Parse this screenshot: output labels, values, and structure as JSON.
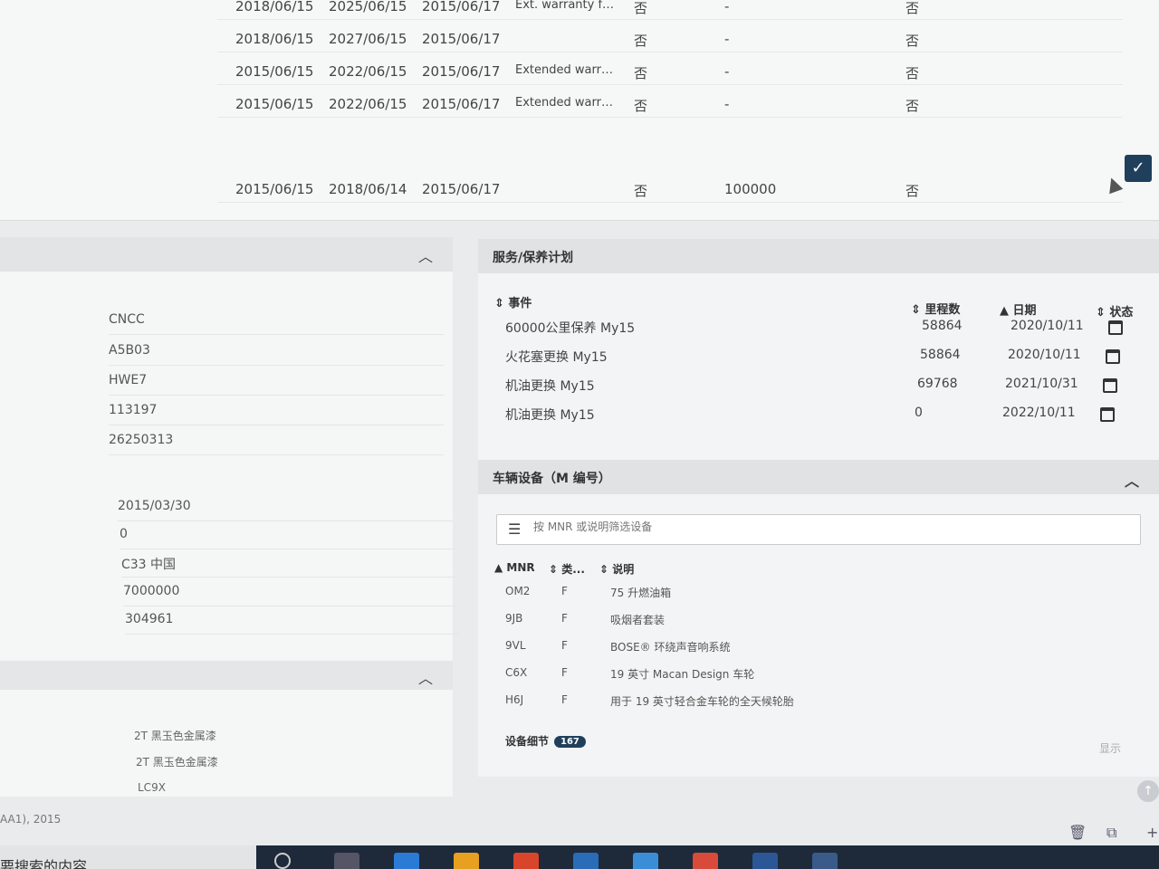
{
  "warranty": {
    "rows": [
      {
        "start": "2018/06/15",
        "end": "2025/06/15",
        "reg": "2015/06/17",
        "desc": "Ext. warranty for ...",
        "flag": "否",
        "mileage": "-",
        "flag2": "否"
      },
      {
        "start": "2018/06/15",
        "end": "2027/06/15",
        "reg": "2015/06/17",
        "desc": "",
        "flag": "否",
        "mileage": "-",
        "flag2": "否"
      },
      {
        "start": "2015/06/15",
        "end": "2022/06/15",
        "reg": "2015/06/17",
        "desc": "Extended warrant...",
        "flag": "否",
        "mileage": "-",
        "flag2": "否"
      },
      {
        "start": "2015/06/15",
        "end": "2022/06/15",
        "reg": "2015/06/17",
        "desc": "Extended warrant...",
        "flag": "否",
        "mileage": "-",
        "flag2": "否"
      },
      {
        "start": "2015/06/15",
        "end": "2018/06/14",
        "reg": "2015/06/17",
        "desc": "",
        "flag": "否",
        "mileage": "100000",
        "flag2": "否"
      }
    ]
  },
  "left": {
    "group1": [
      "CNCC",
      "A5B03",
      "HWE7",
      "113197",
      "26250313"
    ],
    "group2": [
      "2015/03/30",
      "0",
      "C33 中国",
      "7000000",
      "304961"
    ],
    "group3": [
      "2T 黑玉色金属漆",
      "2T 黑玉色金属漆",
      "LC9X"
    ],
    "footer": "AA1), 2015"
  },
  "service": {
    "title": "服务/保养计划",
    "headers": {
      "event": "事件",
      "mileage": "里程数",
      "date": "日期",
      "status": "状态"
    },
    "rows": [
      {
        "event": "60000公里保养 My15",
        "mileage": "58864",
        "date": "2020/10/11"
      },
      {
        "event": "火花塞更换 My15",
        "mileage": "58864",
        "date": "2020/10/11"
      },
      {
        "event": "机油更换 My15",
        "mileage": "69768",
        "date": "2021/10/31"
      },
      {
        "event": "机油更换 My15",
        "mileage": "0",
        "date": "2022/10/11"
      }
    ]
  },
  "equipment": {
    "title": "车辆设备（M 编号）",
    "filter_placeholder": "按 MNR 或说明筛选设备",
    "headers": {
      "mnr": "MNR",
      "type": "类...",
      "desc": "说明"
    },
    "rows": [
      {
        "mnr": "OM2",
        "type": "F",
        "desc": "75 升燃油箱"
      },
      {
        "mnr": "9JB",
        "type": "F",
        "desc": "吸烟者套装"
      },
      {
        "mnr": "9VL",
        "type": "F",
        "desc": "BOSE® 环绕声音响系统"
      },
      {
        "mnr": "C6X",
        "type": "F",
        "desc": "19 英寸 Macan Design 车轮"
      },
      {
        "mnr": "H6J",
        "type": "F",
        "desc": "用于 19 英寸轻合金车轮的全天候轮胎"
      }
    ],
    "details_label": "设备细节",
    "details_count": "167",
    "show_label": "显示"
  },
  "taskbar": {
    "search_text": "要搜索的内容"
  }
}
